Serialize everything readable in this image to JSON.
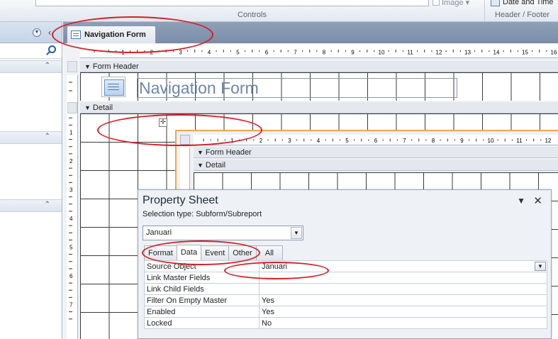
{
  "ribbon": {
    "image_label": "Image ▾",
    "date_time_label": "Date and Time",
    "group_controls": "Controls",
    "group_header_footer": "Header / Footer"
  },
  "nav_pane": {
    "dropdown_icon": "chevron-down-circle-icon",
    "collapse_icon": "double-chevron-left-icon",
    "search_icon": "search-icon",
    "group_chevron": "⌃"
  },
  "document": {
    "tab_label": "Navigation Form",
    "form_header_label": "Form Header",
    "detail_label": "Detail",
    "title_text": "Navigation Form",
    "hruler_ticks": [
      "1",
      "2",
      "3",
      "4",
      "5",
      "6",
      "7",
      "8",
      "9",
      "10",
      "11",
      "12",
      "13",
      "14",
      "15",
      "16"
    ],
    "vruler_ticks": [
      "1",
      "2",
      "3",
      "4",
      "5",
      "6",
      "7"
    ]
  },
  "subform": {
    "form_header_label": "Form Header",
    "detail_label": "Detail",
    "ruler_ticks": [
      "1",
      "2",
      "3",
      "4",
      "5",
      "6",
      "7",
      "8",
      "9",
      "10",
      "11",
      "12"
    ]
  },
  "property_sheet": {
    "title": "Property Sheet",
    "selection_type": "Selection type:  Subform/Subreport",
    "selected_object": "Januari",
    "tabs": [
      "Format",
      "Data",
      "Event",
      "Other",
      "All"
    ],
    "active_tab": "Data",
    "rows": [
      {
        "name": "Source Object",
        "value": "Januari"
      },
      {
        "name": "Link Master Fields",
        "value": ""
      },
      {
        "name": "Link Child Fields",
        "value": ""
      },
      {
        "name": "Filter On Empty Master",
        "value": "Yes"
      },
      {
        "name": "Enabled",
        "value": "Yes"
      },
      {
        "name": "Locked",
        "value": "No"
      }
    ]
  },
  "colors": {
    "annotation": "#d81f26",
    "subform_border": "#f3a64a",
    "tab_bar": "#8fa0b8"
  }
}
